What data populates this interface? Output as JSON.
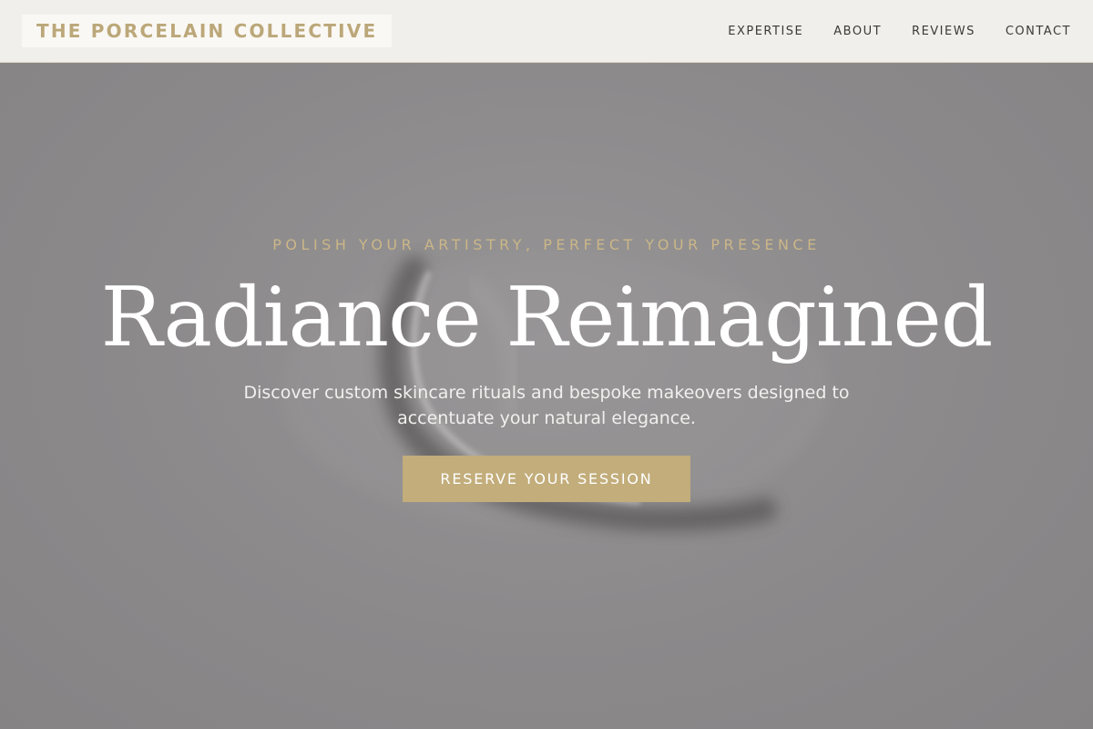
{
  "brand": {
    "name": "THE PORCELAIN COLLECTIVE"
  },
  "nav": {
    "items": [
      {
        "label": "EXPERTISE"
      },
      {
        "label": "ABOUT"
      },
      {
        "label": "REVIEWS"
      },
      {
        "label": "CONTACT"
      }
    ]
  },
  "hero": {
    "eyebrow": "POLISH YOUR ARTISTRY, PERFECT YOUR PRESENCE",
    "title": "Radiance Reimagined",
    "subtitle": "Discover custom skincare rituals and bespoke makeovers designed to accentuate your natural elegance.",
    "cta_label": "RESERVE YOUR SESSION"
  },
  "colors": {
    "accent_gold": "#c2ad7b",
    "brand_gold": "#bba779",
    "header_bg": "#f1efeb",
    "hero_overlay": "#8a8889"
  }
}
